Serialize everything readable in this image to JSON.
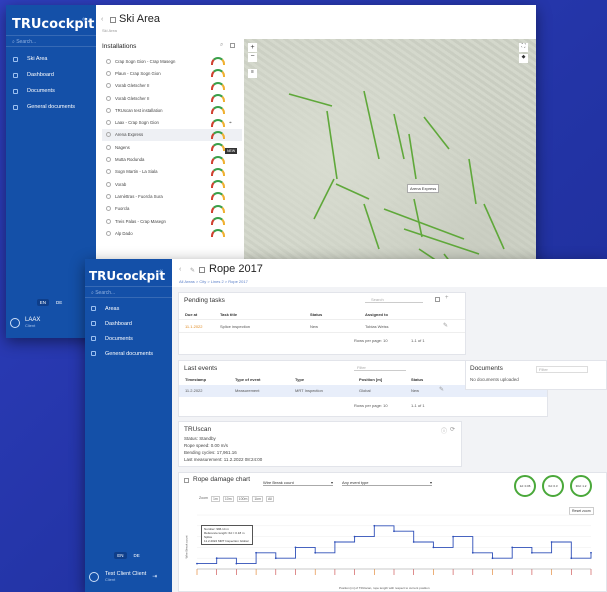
{
  "win1": {
    "logo": "TRUcockpit",
    "search": "Search...",
    "nav": [
      {
        "label": "Ski Area"
      },
      {
        "label": "Dashboard"
      },
      {
        "label": "Documents"
      },
      {
        "label": "General documents"
      }
    ],
    "lang": [
      "EN",
      "DE"
    ],
    "user": {
      "name": "LAAX",
      "role": "Client"
    },
    "title": "Ski Area",
    "breadcrumb": "Ski Area",
    "installations_title": "Installations",
    "installations": [
      "Crap Sogn Gion - Crap Masegn",
      "Plaun - Crap Sogn Gion",
      "Vorab Gletscher II",
      "Vorab Gletscher II",
      "TRUscan test installation",
      "Laax - Crap Sogn Gion",
      "Arena Express",
      "Nagens",
      "Mutta Rodunda",
      "Sogn Martin - La Siala",
      "Vorab",
      "Larnèttras - Fuorcla Sura",
      "Fuorcla",
      "Treis Palas - Crap Masegn",
      "Alp Dado"
    ],
    "tooltip": "NEW",
    "map_label": "Arena Express"
  },
  "win2": {
    "logo": "TRUcockpit",
    "search": "Search...",
    "nav": [
      {
        "label": "Areas"
      },
      {
        "label": "Dashboard"
      },
      {
        "label": "Documents"
      },
      {
        "label": "General documents"
      }
    ],
    "lang": [
      "EN",
      "DE"
    ],
    "user": {
      "name": "Test Client Client",
      "role": "Client"
    },
    "title": "Rope 2017",
    "breadcrumb": "All Areas > City > Lines 2 > Rope 2017",
    "pending": {
      "title": "Pending tasks",
      "search": "Search",
      "cols": [
        "Due at",
        "Task title",
        "Status",
        "Assigned to"
      ],
      "rows": [
        [
          "11.1.2022",
          "Splice inspection",
          "New",
          "Tobias Weiss"
        ]
      ],
      "footer": "Rows per page: 10",
      "range": "1-1 of 1"
    },
    "events": {
      "title": "Last events",
      "search": "Filter",
      "cols": [
        "Timestamp",
        "Type of event",
        "Type",
        "Position [m]",
        "Status"
      ],
      "rows": [
        [
          "11.2.2022",
          "Measurement",
          "MRT Inspection",
          "Global",
          "New"
        ]
      ],
      "footer": "Rows per page: 10",
      "range": "1-1 of 1"
    },
    "docs": {
      "title": "Documents",
      "search": "Filter",
      "empty": "No documents uploaded"
    },
    "truscan": {
      "title": "TRUscan",
      "lines": [
        "Status: Standby",
        "Rope speed: 0.00 m/s",
        "Bending cycles: 17,961.16",
        "Last measurement: 11.2.2022 08:24:00"
      ]
    },
    "chart": {
      "title": "Rope damage chart",
      "select1": "Wire Break count",
      "select2": "Any event type",
      "reset": "Reset zoom",
      "zoom": [
        "Zoom",
        "1m",
        "10m",
        "100m",
        "1km",
        "All"
      ],
      "tooltip_lines": [
        "Number: 996.14 m",
        "Reference length: 6d = 0.18 m",
        "Splice",
        "11.2.2022 MRT Inspection Global"
      ],
      "xlabel": "Position [m] of TRUscan, rope length with respect to current position",
      "ylabel": "Wire Break count",
      "circles": [
        "1d: 0.06",
        "6d: 0.3",
        "30d: 1.2"
      ]
    }
  },
  "chart_data": {
    "type": "line",
    "title": "Rope damage chart",
    "ylabel": "Wire Break count",
    "x": [
      0,
      100,
      200,
      300,
      400,
      500,
      600,
      700,
      800,
      900,
      1000,
      1100,
      1200,
      1300,
      1400,
      1500,
      1600,
      1700,
      1800,
      1900,
      2000
    ],
    "values": [
      1,
      2,
      1,
      3,
      2,
      4,
      3,
      5,
      6,
      8,
      7,
      5,
      4,
      6,
      3,
      2,
      4,
      3,
      5,
      2,
      3
    ]
  }
}
